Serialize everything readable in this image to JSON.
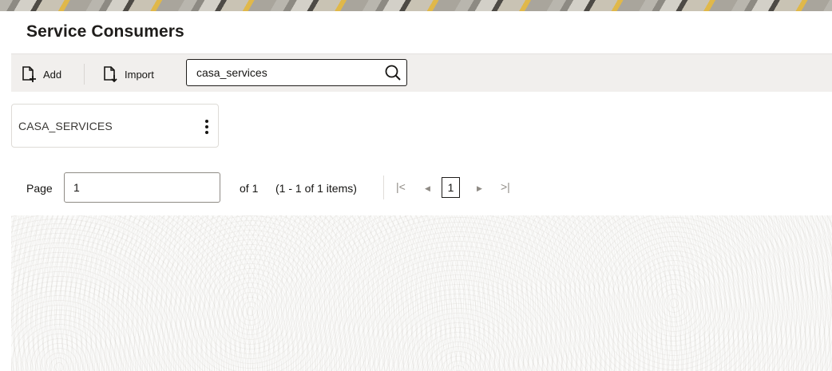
{
  "page": {
    "title": "Service Consumers"
  },
  "toolbar": {
    "add_label": "Add",
    "import_label": "Import",
    "search_value": "casa_services"
  },
  "cards": [
    {
      "label": "CASA_SERVICES"
    }
  ],
  "pagination": {
    "page_label": "Page",
    "page_value": "1",
    "of_label": "of 1",
    "range_label": "(1 - 1 of 1 items)",
    "first_glyph": "|<",
    "prev_glyph": "◀",
    "current_page": "1",
    "next_glyph": "▶",
    "last_glyph": ">|"
  }
}
